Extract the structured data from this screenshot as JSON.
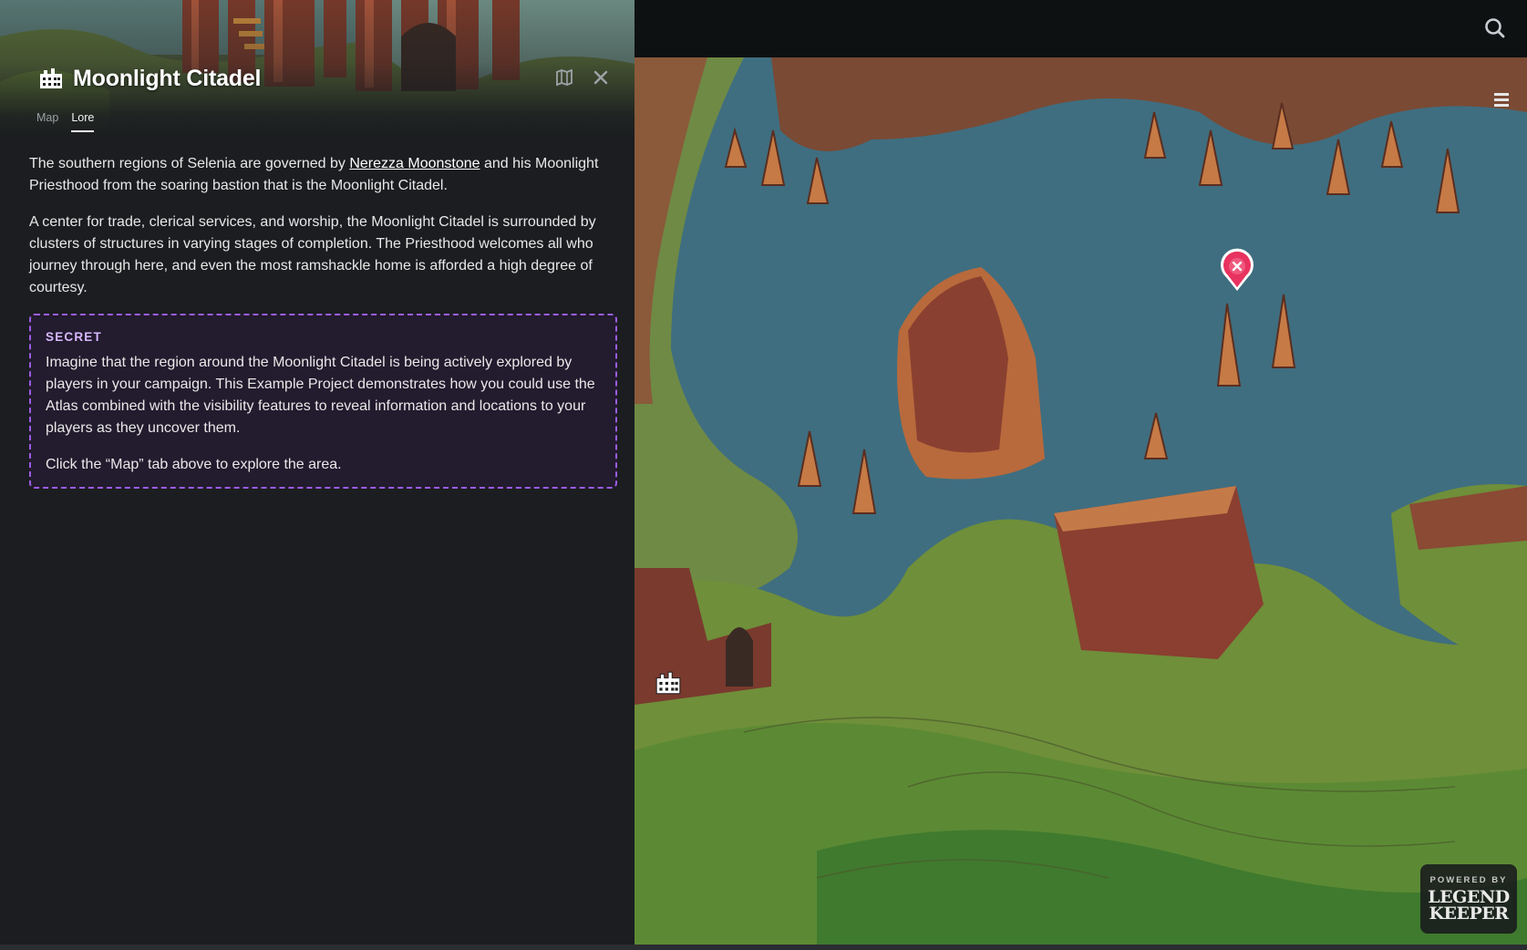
{
  "article": {
    "title": "Moonlight Citadel",
    "title_icon": "building-icon",
    "tabs": [
      {
        "label": "Map",
        "active": false
      },
      {
        "label": "Lore",
        "active": true
      }
    ],
    "actions": {
      "open_map_icon": "map-pin-icon",
      "close_icon": "close-icon"
    },
    "lore": {
      "p1_before_link": "The southern regions of Selenia are governed by ",
      "p1_link": "Nerezza Moonstone",
      "p1_after_link": " and his Moonlight Priesthood from the soaring bastion that is the Moonlight Citadel.",
      "p2": "A center for trade, clerical services, and worship, the Moonlight Citadel is surrounded by clusters of structures in varying stages of completion. The Priesthood welcomes all who journey through here, and even the most ramshackle home is afforded a high degree of courtesy."
    },
    "secret": {
      "label": "SECRET",
      "p1": "Imagine that the region around the Moonlight Citadel is being actively explored by players in your campaign. This Example Project demonstrates how you could use the Atlas combined with the visibility features to reveal information and locations to your players as they uncover them.",
      "p2": "Click the “Map” tab above to explore the area."
    }
  },
  "map_viewer": {
    "search_icon": "search-icon",
    "menu_icon": "hamburger-menu-icon",
    "pin_icon": "close-pin-icon",
    "marker_icon": "building-icon",
    "badge": {
      "top": "POWERED BY",
      "line1": "LEGEND",
      "line2": "KEEPER"
    }
  },
  "colors": {
    "panel_bg": "#1b1d20",
    "secret_border": "#9b5de5",
    "secret_label": "#d7b8ff",
    "pin": "#e8325f",
    "water": "#3f6e80"
  }
}
